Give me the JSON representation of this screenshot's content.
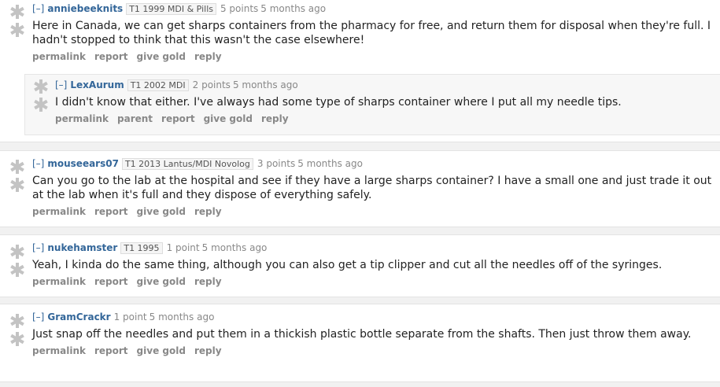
{
  "comments": [
    {
      "expand": "[–]",
      "author": "anniebeeknits",
      "flair": "T1 1999 MDI & Pills",
      "score": "5 points",
      "time": "5 months ago",
      "body": "Here in Canada, we can get sharps containers from the pharmacy for free, and return them for disposal when they're full. I hadn't stopped to think that this wasn't the case elsewhere!",
      "buttons": [
        "permalink",
        "report",
        "give gold",
        "reply"
      ],
      "reply": {
        "expand": "[–]",
        "author": "LexAurum",
        "flair": "T1 2002 MDI",
        "score": "2 points",
        "time": "5 months ago",
        "body": "I didn't know that either. I've always had some type of sharps container where I put all my needle tips.",
        "buttons": [
          "permalink",
          "parent",
          "report",
          "give gold",
          "reply"
        ]
      }
    },
    {
      "expand": "[–]",
      "author": "mouseears07",
      "flair": "T1 2013 Lantus/MDI Novolog",
      "score": "3 points",
      "time": "5 months ago",
      "body": "Can you go to the lab at the hospital and see if they have a large sharps container? I have a small one and just trade it out at the lab when it's full and they dispose of everything safely.",
      "buttons": [
        "permalink",
        "report",
        "give gold",
        "reply"
      ]
    },
    {
      "expand": "[–]",
      "author": "nukehamster",
      "flair": "T1 1995",
      "score": "1 point",
      "time": "5 months ago",
      "body": "Yeah, I kinda do the same thing, although you can also get a tip clipper and cut all the needles off of the syringes.",
      "buttons": [
        "permalink",
        "report",
        "give gold",
        "reply"
      ]
    },
    {
      "expand": "[–]",
      "author": "GramCrackr",
      "flair": "",
      "score": "1 point",
      "time": "5 months ago",
      "body": "Just snap off the needles and put them in a thickish plastic bottle separate from the shafts. Then just throw them away.",
      "buttons": [
        "permalink",
        "report",
        "give gold",
        "reply"
      ]
    }
  ],
  "icons": {
    "upvote": "upvote-icon",
    "downvote": "downvote-icon"
  },
  "colors": {
    "author": "#336699",
    "meta": "#888888",
    "icon": "#c3c3c3"
  }
}
